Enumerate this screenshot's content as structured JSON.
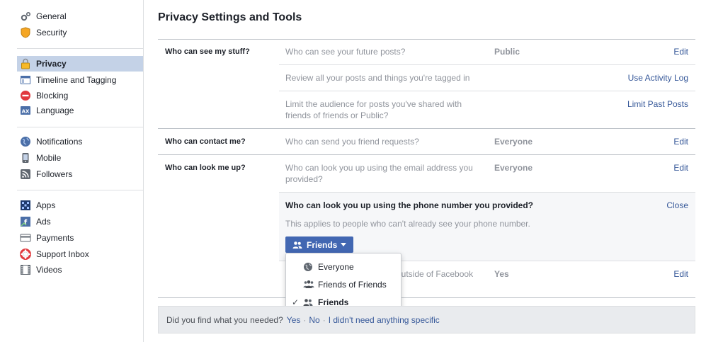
{
  "sidebar": {
    "groups": [
      [
        {
          "label": "General",
          "icon": "gear-icon"
        },
        {
          "label": "Security",
          "icon": "shield-icon"
        }
      ],
      [
        {
          "label": "Privacy",
          "icon": "lock-icon",
          "active": true
        },
        {
          "label": "Timeline and Tagging",
          "icon": "timeline-icon"
        },
        {
          "label": "Blocking",
          "icon": "block-icon"
        },
        {
          "label": "Language",
          "icon": "language-icon"
        }
      ],
      [
        {
          "label": "Notifications",
          "icon": "globe-icon"
        },
        {
          "label": "Mobile",
          "icon": "mobile-icon"
        },
        {
          "label": "Followers",
          "icon": "rss-icon"
        }
      ],
      [
        {
          "label": "Apps",
          "icon": "apps-icon"
        },
        {
          "label": "Ads",
          "icon": "ads-icon"
        },
        {
          "label": "Payments",
          "icon": "card-icon"
        },
        {
          "label": "Support Inbox",
          "icon": "lifebuoy-icon"
        },
        {
          "label": "Videos",
          "icon": "film-icon"
        }
      ]
    ]
  },
  "main": {
    "title": "Privacy Settings and Tools",
    "sections": [
      {
        "label": "Who can see my stuff?",
        "rows": [
          {
            "question": "Who can see your future posts?",
            "value": "Public",
            "action": "Edit"
          },
          {
            "question": "Review all your posts and things you're tagged in",
            "value": "",
            "action": "Use Activity Log"
          },
          {
            "question": "Limit the audience for posts you've shared with friends of friends or Public?",
            "value": "",
            "action": "Limit Past Posts"
          }
        ]
      },
      {
        "label": "Who can contact me?",
        "rows": [
          {
            "question": "Who can send you friend requests?",
            "value": "Everyone",
            "action": "Edit"
          }
        ]
      },
      {
        "label": "Who can look me up?",
        "rows": [
          {
            "question": "Who can look you up using the email address you provided?",
            "value": "Everyone",
            "action": "Edit"
          },
          {
            "question": "outside of Facebook",
            "value": "Yes",
            "action": "Edit"
          }
        ]
      }
    ],
    "expanded": {
      "title": "Who can look you up using the phone number you provided?",
      "close": "Close",
      "description": "This applies to people who can't already see your phone number.",
      "button_label": "Friends"
    },
    "dropdown": {
      "options": [
        {
          "label": "Everyone",
          "icon": "globe-icon",
          "selected": false
        },
        {
          "label": "Friends of Friends",
          "icon": "friends-of-friends-icon",
          "selected": false
        },
        {
          "label": "Friends",
          "icon": "friends-icon",
          "selected": true
        }
      ]
    },
    "feedback": {
      "question": "Did you find what you needed?",
      "yes": "Yes",
      "no": "No",
      "other": "I didn't need anything specific"
    }
  },
  "colors": {
    "link": "#365899",
    "active_sidebar": "#c4d2e7",
    "button": "#4267b2",
    "muted": "#90949c"
  }
}
